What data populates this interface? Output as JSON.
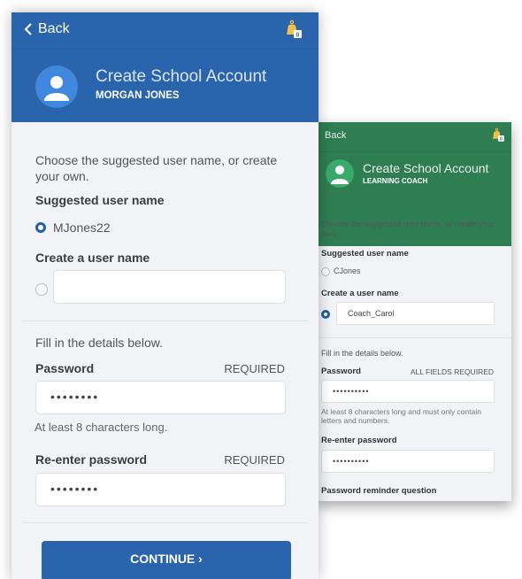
{
  "back_panel": {
    "theme_color": "#2f7d52",
    "topbar": {
      "back_label": "Back",
      "notification_count": "0"
    },
    "header": {
      "title": "Create School Account",
      "subtitle": "LEARNING COACH"
    },
    "intro": "Choose the suggested user name, or create your own.",
    "suggested_label": "Suggested user name",
    "suggested_value": "CJones",
    "suggested_selected": false,
    "create_label": "Create a user name",
    "create_value": "Coach_Carol",
    "create_selected": true,
    "details_intro": "Fill in the details below.",
    "password_label": "Password",
    "required_note": "ALL FIELDS REQUIRED",
    "password_value": "••••••••••",
    "password_hint": "At least 8 characters long and must only contain letters and numbers.",
    "reenter_label": "Re-enter password",
    "reenter_value": "••••••••••",
    "reminder_label": "Password reminder question"
  },
  "front_panel": {
    "theme_color": "#2a64ad",
    "topbar": {
      "back_label": "Back",
      "notification_count": "0"
    },
    "header": {
      "title": "Create School Account",
      "subtitle": "MORGAN JONES"
    },
    "intro": "Choose the suggested user name, or create your own.",
    "suggested_label": "Suggested user name",
    "suggested_value": "MJones22",
    "suggested_selected": true,
    "create_label": "Create a user name",
    "create_value": "",
    "create_selected": false,
    "details_intro": "Fill in the details below.",
    "password_label": "Password",
    "password_required": "REQUIRED",
    "password_value": "••••••••",
    "password_hint": "At least 8 characters long.",
    "reenter_label": "Re-enter password",
    "reenter_required": "REQUIRED",
    "reenter_value": "••••••••",
    "continue_label": "CONTINUE ›"
  }
}
